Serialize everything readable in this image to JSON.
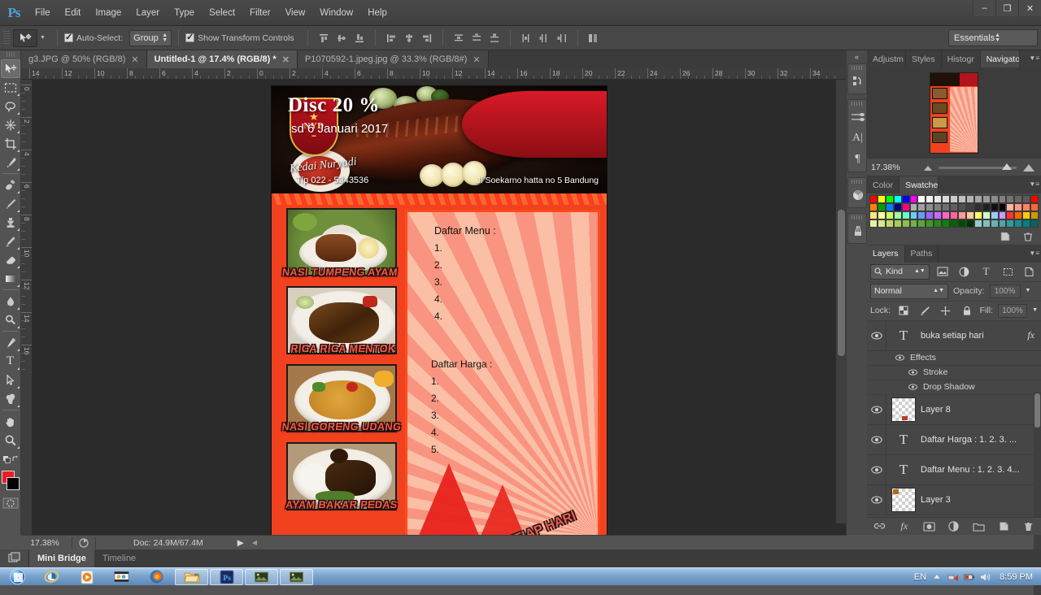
{
  "app": {
    "name": "Adobe Photoshop",
    "logo_text": "Ps",
    "workspace": "Essentials"
  },
  "menu": {
    "items": [
      "File",
      "Edit",
      "Image",
      "Layer",
      "Type",
      "Select",
      "Filter",
      "View",
      "Window",
      "Help"
    ]
  },
  "window_controls": {
    "minimize": "–",
    "restore": "❐",
    "close": "✕"
  },
  "options_bar": {
    "tool_icon": "move-tool-icon",
    "auto_select_label": "Auto-Select:",
    "auto_select_value": "Group",
    "show_transform_label": "Show Transform Controls",
    "align_icons": [
      "align-top-edges",
      "align-vertical-centers",
      "align-bottom-edges",
      "align-left-edges",
      "align-horizontal-centers",
      "align-right-edges",
      "distribute-top-edges",
      "distribute-vertical-centers",
      "distribute-bottom-edges",
      "distribute-left-edges",
      "distribute-horizontal-centers",
      "distribute-right-edges",
      "auto-align-layers"
    ]
  },
  "tabs": [
    {
      "label": "g3.JPG @ 50% (RGB/8)",
      "active": false
    },
    {
      "label": "Untitled-1 @ 17.4% (RGB/8) *",
      "active": true
    },
    {
      "label": "P1070592-1.jpeg.jpg @ 33.3% (RGB/8#)",
      "active": false
    }
  ],
  "rulers": {
    "horizontal": [
      "14",
      "12",
      "10",
      "8",
      "6",
      "4",
      "2",
      "0",
      "2",
      "4",
      "6",
      "8",
      "10",
      "12",
      "14",
      "16",
      "18",
      "20",
      "22",
      "24",
      "26",
      "28",
      "30",
      "32",
      "34"
    ],
    "vertical": [
      "0",
      "2",
      "4",
      "6",
      "8",
      "10",
      "12",
      "14",
      "16"
    ]
  },
  "toolbar": {
    "tools": [
      "move-tool",
      "rectangular-marquee-tool",
      "lasso-tool",
      "magic-wand-tool",
      "crop-tool",
      "eyedropper-tool",
      "spot-healing-brush-tool",
      "brush-tool",
      "clone-stamp-tool",
      "history-brush-tool",
      "eraser-tool",
      "gradient-tool",
      "blur-tool",
      "dodge-tool",
      "pen-tool",
      "horizontal-type-tool",
      "path-selection-tool",
      "custom-shape-tool",
      "hand-tool",
      "zoom-tool"
    ],
    "foreground_color": "#ed1c24",
    "background_color": "#000000"
  },
  "document": {
    "banner": {
      "logo_initials": "NYD",
      "brand_name": "Kedai Nuryadi",
      "phone": "Tlp 022 - 5343536",
      "address": "Jl Soekarno hatta no 5 Bandung",
      "discount_headline": "Disc 20 %",
      "discount_valid": "sd 6 Januari 2017"
    },
    "menu_heading": "Daftar Menu :",
    "menu_items": [
      "1.",
      "2.",
      "3.",
      "4.",
      "4."
    ],
    "price_heading": "Daftar Harga :",
    "price_items": [
      "1.",
      "2.",
      "3.",
      "4.",
      "5."
    ],
    "food_labels": [
      "NASI TUMPENG AYAM",
      "RICA RICA MENTOK",
      "NASI GORENG UDANG",
      "AYAM BAKAR PEDAS"
    ],
    "open_text": "BUKA SETIAP HARI"
  },
  "status_bar": {
    "zoom": "17.38%",
    "doc_size": "Doc: 24.9M/67.4M"
  },
  "icon_dock": {
    "collapse": "«",
    "icons": [
      "history-icon",
      "adjustments-icon",
      "character-icon",
      "paragraph-icon",
      "color-wheel-icon",
      "brush-presets-icon"
    ]
  },
  "navigator_panel": {
    "tabs": [
      "Adjustm",
      "Styles",
      "Histogr",
      "Navigator"
    ],
    "active_tab": "Navigator",
    "zoom_value": "17.38%"
  },
  "color_panel": {
    "tabs": [
      "Color",
      "Swatches"
    ],
    "active_tab": "Swatches",
    "swatch_rows": [
      [
        "#ff0000",
        "#ffff00",
        "#00ff00",
        "#00ffff",
        "#0000ff",
        "#ff00ff",
        "#ffffff",
        "#f2f2f2",
        "#e6e6e6",
        "#d9d9d9",
        "#cccccc",
        "#bfbfbf",
        "#b3b3b3",
        "#a6a6a6",
        "#999999",
        "#8c8c8c",
        "#808080",
        "#737373",
        "#666666",
        "#595959",
        "#ff0000"
      ],
      [
        "#ff8000",
        "#00a000",
        "#0080ff",
        "#000080",
        "#ff0080",
        "#b0b0b0",
        "#a0a0a0",
        "#909090",
        "#808080",
        "#707070",
        "#606060",
        "#505050",
        "#404040",
        "#303030",
        "#202020",
        "#101010",
        "#000000",
        "#ffb3a0",
        "#ff9980",
        "#ff8066",
        "#ff6633"
      ],
      [
        "#ffe680",
        "#ffff99",
        "#ccff66",
        "#99ff99",
        "#66ffcc",
        "#66ccff",
        "#6699ff",
        "#9966ff",
        "#cc66ff",
        "#ff66cc",
        "#ff6699",
        "#ff9999",
        "#ffcc99",
        "#ffff66",
        "#ccffcc",
        "#99ccff",
        "#cc99ff",
        "#ff3333",
        "#ff6600",
        "#ffcc00",
        "#cc9900"
      ],
      [
        "#e6f2a0",
        "#d9e68c",
        "#bfd966",
        "#a6cc59",
        "#8cbf4d",
        "#73b340",
        "#59a633",
        "#409926",
        "#268c1a",
        "#0d800d",
        "#006600",
        "#004d00",
        "#003300",
        "#99cccc",
        "#80bfbf",
        "#66b3b3",
        "#4da6a6",
        "#339999",
        "#1a8c8c",
        "#008080",
        "#006666"
      ]
    ]
  },
  "layers_panel": {
    "tabs": [
      "Layers",
      "Paths"
    ],
    "active_tab": "Layers",
    "filter_label": "Kind",
    "blend_mode": "Normal",
    "opacity_label": "Opacity:",
    "opacity_value": "100%",
    "lock_label": "Lock:",
    "fill_label": "Fill:",
    "fill_value": "100%",
    "lock_icons": [
      "lock-transparent-pixels",
      "lock-image-pixels",
      "lock-position",
      "lock-all"
    ],
    "filter_type_icons": [
      "filter-pixel-icon",
      "filter-adjustment-icon",
      "filter-type-icon",
      "filter-shape-icon",
      "filter-smart-object-icon"
    ],
    "layers": [
      {
        "name": "buka setiap hari",
        "type": "text",
        "visible": true,
        "has_fx": true,
        "effects_label": "Effects",
        "effects": [
          "Stroke",
          "Drop Shadow"
        ]
      },
      {
        "name": "Layer 8",
        "type": "pixel",
        "visible": true,
        "has_fx": false
      },
      {
        "name": "Daftar Harga : 1. 2. 3. ...",
        "type": "text",
        "visible": true,
        "has_fx": false
      },
      {
        "name": "Daftar Menu : 1. 2. 3. 4...",
        "type": "text",
        "visible": true,
        "has_fx": false
      },
      {
        "name": "Layer 3",
        "type": "pixel",
        "visible": true,
        "has_fx": false
      }
    ],
    "footer_icons": [
      "link-layers-icon",
      "add-layer-style-icon",
      "add-layer-mask-icon",
      "new-adjustment-layer-icon",
      "new-group-icon",
      "new-layer-icon",
      "delete-layer-icon"
    ]
  },
  "bottom_dock": {
    "tabs": [
      "Mini Bridge",
      "Timeline"
    ],
    "active_tab": "Mini Bridge"
  },
  "taskbar": {
    "start_label": "start-orb",
    "pinned": [
      "internet-explorer-icon",
      "windows-media-player-icon",
      "movie-maker-icon",
      "firefox-icon"
    ],
    "running": [
      "file-explorer-icon",
      "photoshop-icon",
      "image-viewer-icon",
      "image-viewer-2-icon"
    ],
    "language": "EN",
    "tray_icons": [
      "show-hidden-icons-arrow",
      "network-icon",
      "battery-icon",
      "volume-icon"
    ],
    "clock": "8:59 PM"
  }
}
